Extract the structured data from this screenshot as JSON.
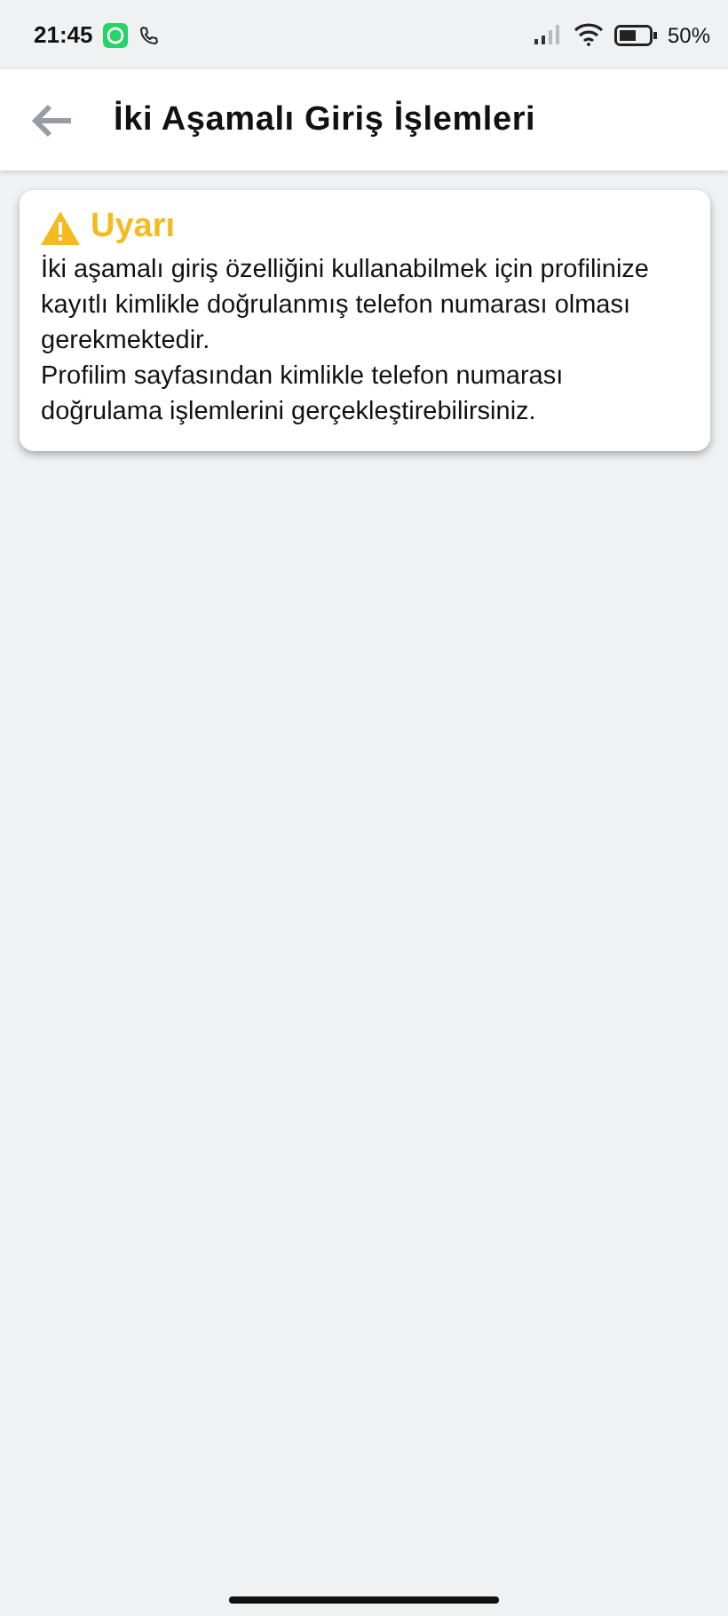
{
  "status_bar": {
    "time": "21:45",
    "battery": "50%"
  },
  "app_bar": {
    "title": "İki Aşamalı Giriş İşlemleri"
  },
  "alert": {
    "title": "Uyarı",
    "paragraphs": [
      "İki aşamalı giriş özelliğini kullanabilmek için profilinize kayıtlı kimlikle doğrulanmış telefon numarası olması gerekmektedir.",
      "Profilim sayfasından kimlikle telefon numarası doğrulama işlemlerini gerçekleştirebilirsiniz."
    ]
  }
}
